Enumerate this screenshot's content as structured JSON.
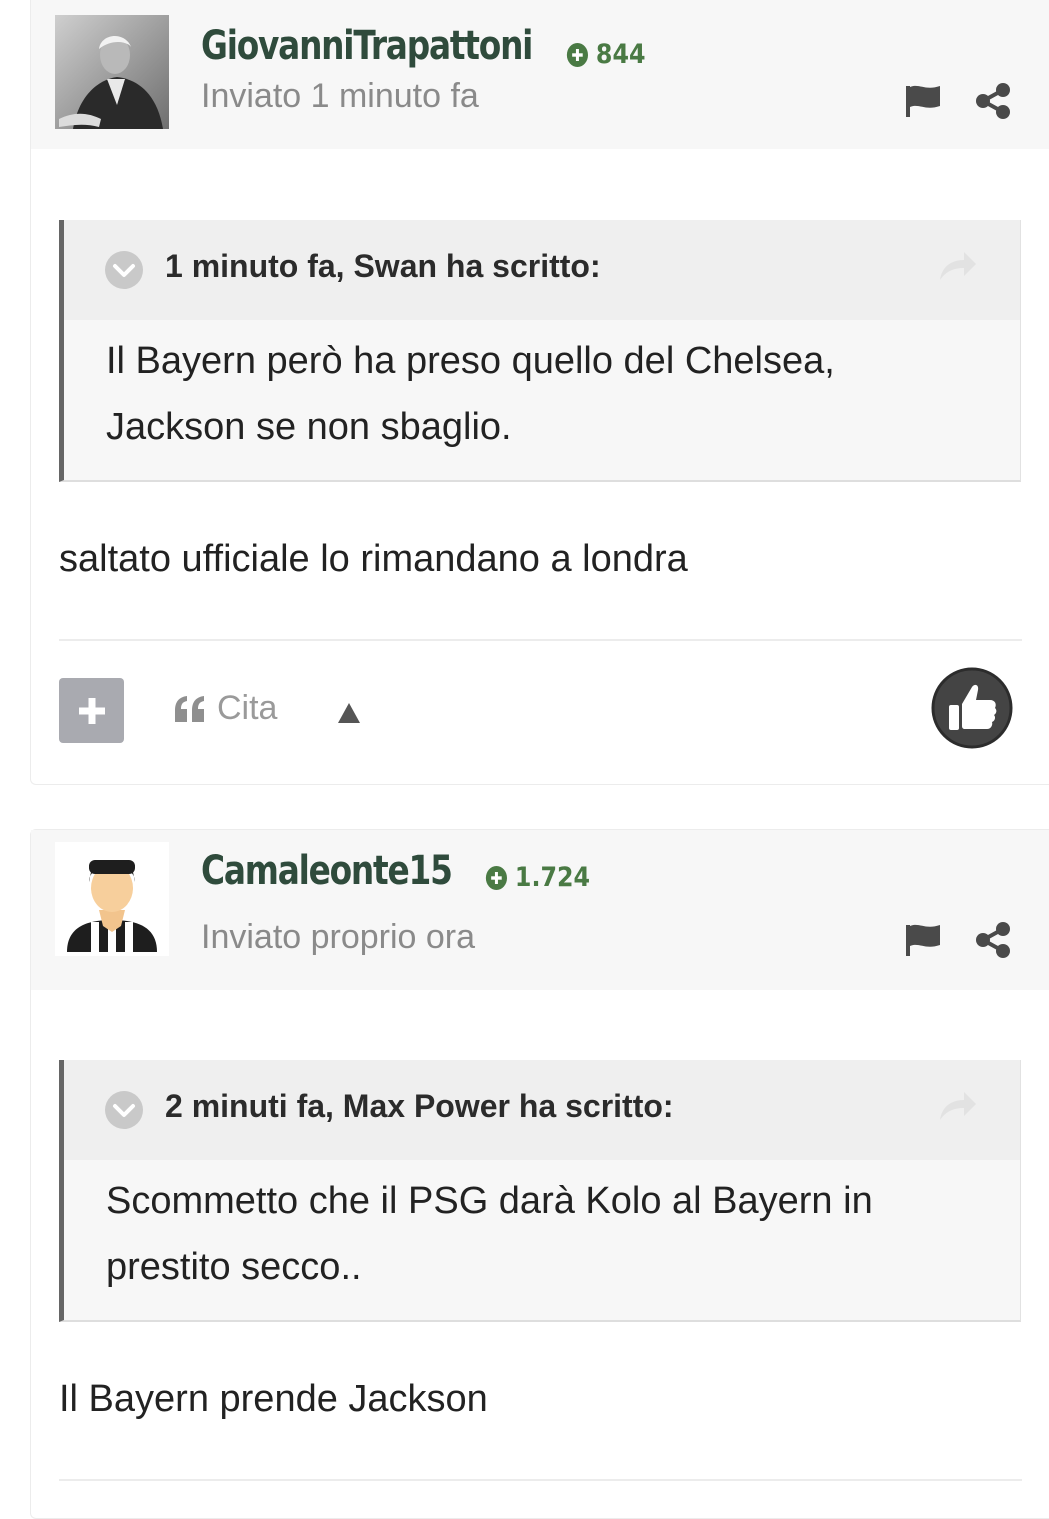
{
  "posts": [
    {
      "author": "GiovanniTrapattoni",
      "reputation": "844",
      "posted": "Inviato 1 minuto fa",
      "quote": {
        "citation": "1 minuto fa, Swan ha scritto:",
        "lines": [
          "Il Bayern però ha preso quello del Chelsea,",
          "Jackson se non sbaglio."
        ]
      },
      "content": "saltato ufficiale lo rimandano a londra",
      "actions": {
        "cite_label": "Cita"
      }
    },
    {
      "author": "Camaleonte15",
      "reputation": "1.724",
      "posted": "Inviato proprio ora",
      "quote": {
        "citation": "2 minuti fa, Max Power ha scritto:",
        "lines": [
          "Scommetto che il PSG darà Kolo al Bayern in",
          "prestito secco.."
        ]
      },
      "content": "Il Bayern prende Jackson"
    }
  ],
  "colors": {
    "username": "#2f4b3c",
    "reputation": "#4a7a44",
    "muted": "#8a8a8a",
    "header_bg": "#f7f7f7",
    "quote_border": "#666666"
  },
  "icons": [
    "flag-icon",
    "share-icon",
    "chevron-down-icon",
    "quote-share-icon",
    "plus-icon",
    "quote-icon",
    "caret-up-icon",
    "thumbs-up-icon"
  ]
}
